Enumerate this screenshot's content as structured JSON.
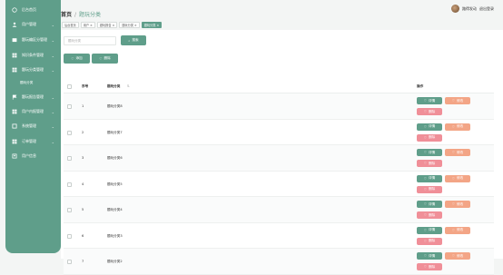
{
  "sidebar": {
    "items": [
      {
        "label": "后台首页",
        "icon": "home-icon",
        "arrow": ""
      },
      {
        "label": "用户管理",
        "icon": "user-icon",
        "arrow": "⌄"
      },
      {
        "label": "题玩编区分管理",
        "icon": "folder-icon",
        "arrow": "⌄"
      },
      {
        "label": "知识条件管理",
        "icon": "grid-icon",
        "arrow": "⌄"
      },
      {
        "label": "题玩分类管理",
        "icon": "grid-icon",
        "arrow": "⌄"
      },
      {
        "label": "题玩分类",
        "icon": "",
        "arrow": ""
      },
      {
        "label": "题玩报告管理",
        "icon": "flag-icon",
        "arrow": "⌄"
      },
      {
        "label": "用户内报管理",
        "icon": "grid-icon",
        "arrow": "⌄"
      },
      {
        "label": "系统管理",
        "icon": "settings-icon",
        "arrow": "⌄"
      },
      {
        "label": "订单管理",
        "icon": "grid-icon",
        "arrow": "⌄"
      },
      {
        "label": "用户信息",
        "icon": "person-icon",
        "arrow": ""
      }
    ]
  },
  "header": {
    "breadcrumb_home": "首页",
    "breadcrumb_sep": "/",
    "breadcrumb_current": "题玩分类",
    "user_name": "路得发动",
    "logout": "退出登录"
  },
  "tabs": [
    {
      "label": "后台首页",
      "active": false
    },
    {
      "label": "用户 ×",
      "active": false
    },
    {
      "label": "题玩报告 ×",
      "active": false
    },
    {
      "label": "题玩分类 ×",
      "active": false
    },
    {
      "label": "题玩分类 ×",
      "active": true
    }
  ],
  "search": {
    "placeholder": "题玩分类",
    "button_label": "搜索"
  },
  "toolbar": {
    "add_label": "添加",
    "delete_label": "删除"
  },
  "table": {
    "headers": {
      "index": "序号",
      "category": "题玩分类",
      "sort_mark": "⇅",
      "actions": "操作"
    },
    "rows": [
      {
        "index": "1",
        "category": "题玩分类8"
      },
      {
        "index": "2",
        "category": "题玩分类7"
      },
      {
        "index": "3",
        "category": "题玩分类6"
      },
      {
        "index": "4",
        "category": "题玩分类5"
      },
      {
        "index": "5",
        "category": "题玩分类4"
      },
      {
        "index": "6",
        "category": "题玩分类3"
      },
      {
        "index": "7",
        "category": "题玩分类2"
      }
    ],
    "actions": {
      "detail": "详情",
      "edit": "修改",
      "delete": "删除"
    }
  },
  "colors": {
    "primary": "#5f9e8a",
    "edit": "#f3a586",
    "delete": "#f08f98"
  }
}
